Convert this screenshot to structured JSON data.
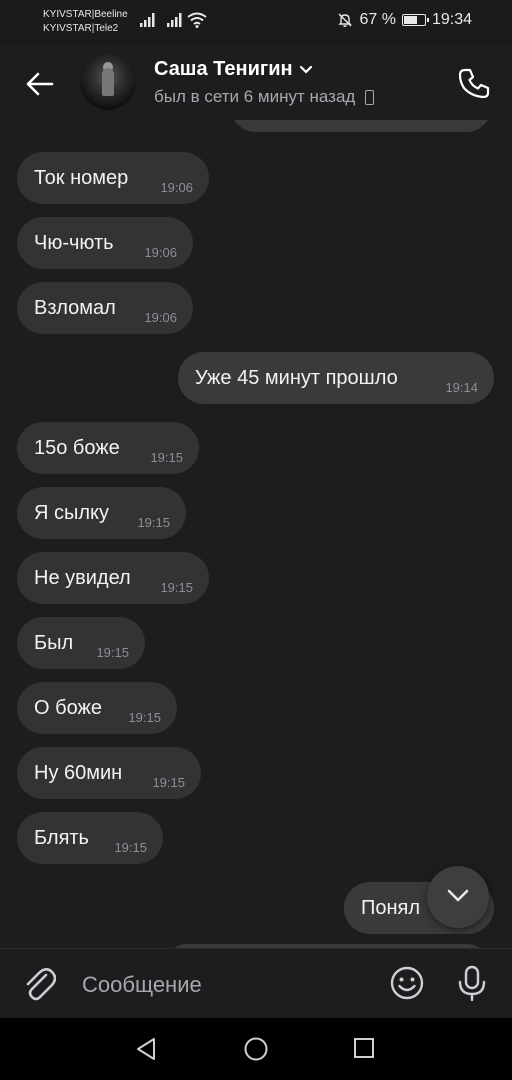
{
  "status_bar": {
    "carrier_1": "KYIVSTAR|Beeline",
    "carrier_2": "KYIVSTAR|Tele2",
    "battery_percent": "67 %",
    "battery_level": 0.67,
    "time": "19:34"
  },
  "header": {
    "contact_name": "Саша Тенигин",
    "last_seen": "был в сети 6 минут назад"
  },
  "messages": [
    {
      "direction": "in",
      "text": "Ток номер",
      "time": "19:06"
    },
    {
      "direction": "in",
      "text": "Чю-чють",
      "time": "19:06"
    },
    {
      "direction": "in",
      "text": "Взломал",
      "time": "19:06"
    },
    {
      "direction": "out",
      "text": "Уже 45 минут прошло",
      "time": "19:14"
    },
    {
      "direction": "in",
      "text": "15о боже",
      "time": "19:15"
    },
    {
      "direction": "in",
      "text": "Я сылку",
      "time": "19:15"
    },
    {
      "direction": "in",
      "text": "Не увидел",
      "time": "19:15"
    },
    {
      "direction": "in",
      "text": "Был",
      "time": "19:15"
    },
    {
      "direction": "in",
      "text": "О боже",
      "time": "19:15"
    },
    {
      "direction": "in",
      "text": "Ну 60мин",
      "time": "19:15"
    },
    {
      "direction": "in",
      "text": "Блять",
      "time": "19:15"
    },
    {
      "direction": "out",
      "text": "Понял",
      "time": ""
    }
  ],
  "composer": {
    "placeholder": "Сообщение"
  },
  "icons": {
    "back": "arrow-left-icon",
    "call": "phone-icon",
    "attach": "paperclip-icon",
    "emoji": "smiley-icon",
    "mic": "microphone-icon",
    "scroll": "chevron-down-icon"
  },
  "colors": {
    "background": "#1d1d1f",
    "bubble_in": "#333335",
    "bubble_out": "#3a3a3c",
    "secondary_text": "#a8a8ac"
  }
}
